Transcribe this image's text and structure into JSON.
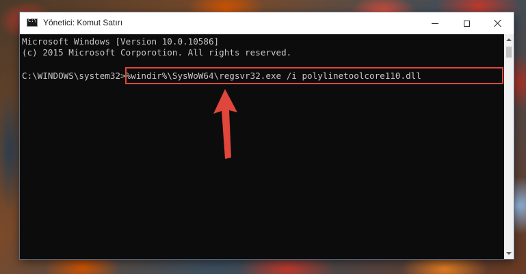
{
  "window": {
    "title": "Yönetici: Komut Satırı",
    "icon": "cmd-icon",
    "controls": [
      "minimize-icon",
      "maximize-icon",
      "close-icon"
    ]
  },
  "console": {
    "lines": [
      "Microsoft Windows [Version 10.0.10586]",
      "(c) 2015 Microsoft Corporotion. All rights reserved."
    ],
    "prompt": "C:\\WINDOWS\\system32>",
    "command": "%windir%\\SysWoW64\\regsvr32.exe /i polylinetoolcore110.dll"
  },
  "annotation": {
    "highlight_color": "#e0463b",
    "arrow_color": "#e0463b",
    "arrow_direction": "up"
  },
  "colors": {
    "console_bg": "#0c0c0c",
    "console_text": "#c8c8c8",
    "titlebar_bg": "#ffffff"
  }
}
